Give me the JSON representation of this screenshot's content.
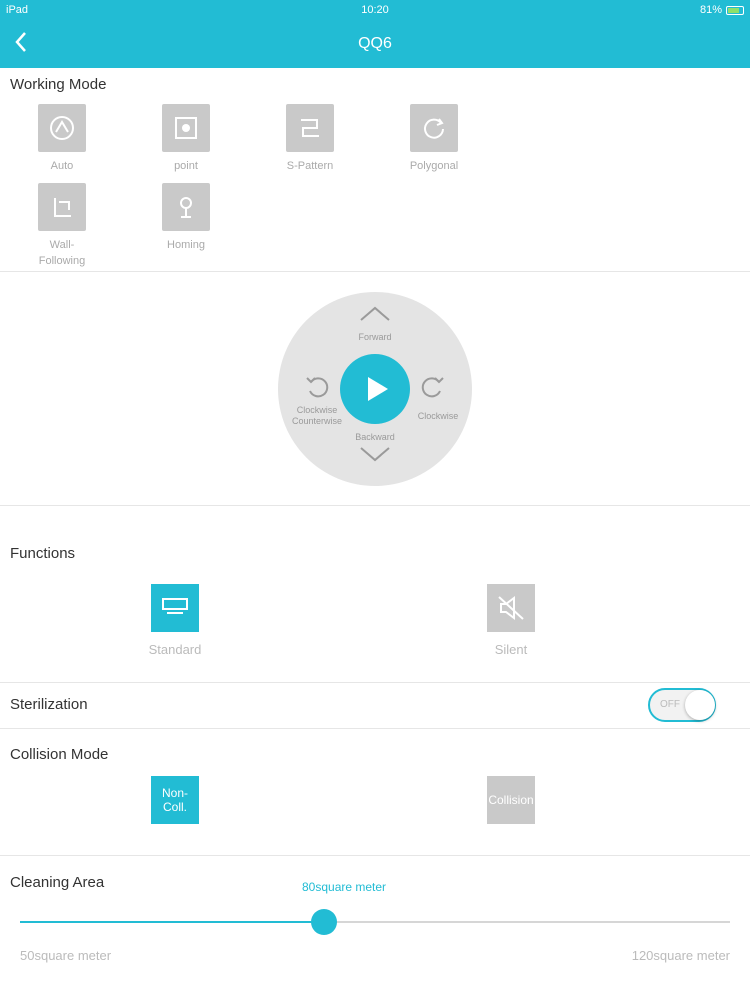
{
  "status": {
    "device": "iPad",
    "time": "10:20",
    "battery": "81%"
  },
  "nav": {
    "back_icon": "chevron-left-icon",
    "title": "QQ6"
  },
  "working_mode": {
    "title": "Working Mode",
    "modes": [
      {
        "label": "Auto",
        "icon": "auto-icon"
      },
      {
        "label": "point",
        "icon": "spot-icon"
      },
      {
        "label": "S-Pattern",
        "icon": "s-pattern-icon"
      },
      {
        "label": "Polygonal",
        "icon": "polygonal-icon"
      },
      {
        "label": "Wall-Following",
        "icon": "wall-following-icon"
      },
      {
        "label": "Homing",
        "icon": "homing-icon"
      }
    ]
  },
  "dpad": {
    "forward": "Forward",
    "backward": "Backward",
    "counterclockwise": "Clockwise Counterwise",
    "clockwise": "Clockwise",
    "play_icon": "play-icon"
  },
  "functions": {
    "title": "Functions",
    "items": [
      {
        "label": "Standard",
        "active": true,
        "icon": "standard-icon"
      },
      {
        "label": "Silent",
        "active": false,
        "icon": "mute-icon"
      }
    ]
  },
  "sterilization": {
    "label": "Sterilization",
    "state_text": "OFF",
    "on": true
  },
  "collision": {
    "title": "Collision Mode",
    "items": [
      {
        "label": "Non-Coll.",
        "active": true
      },
      {
        "label": "Collision",
        "active": false
      }
    ]
  },
  "cleaning_area": {
    "title": "Cleaning Area",
    "value_text": "80square meter",
    "min_text": "50square meter",
    "max_text": "120square meter",
    "min": 50,
    "max": 120,
    "value": 80
  },
  "colors": {
    "accent": "#22bcd4",
    "inactive": "#c9c9c9"
  }
}
